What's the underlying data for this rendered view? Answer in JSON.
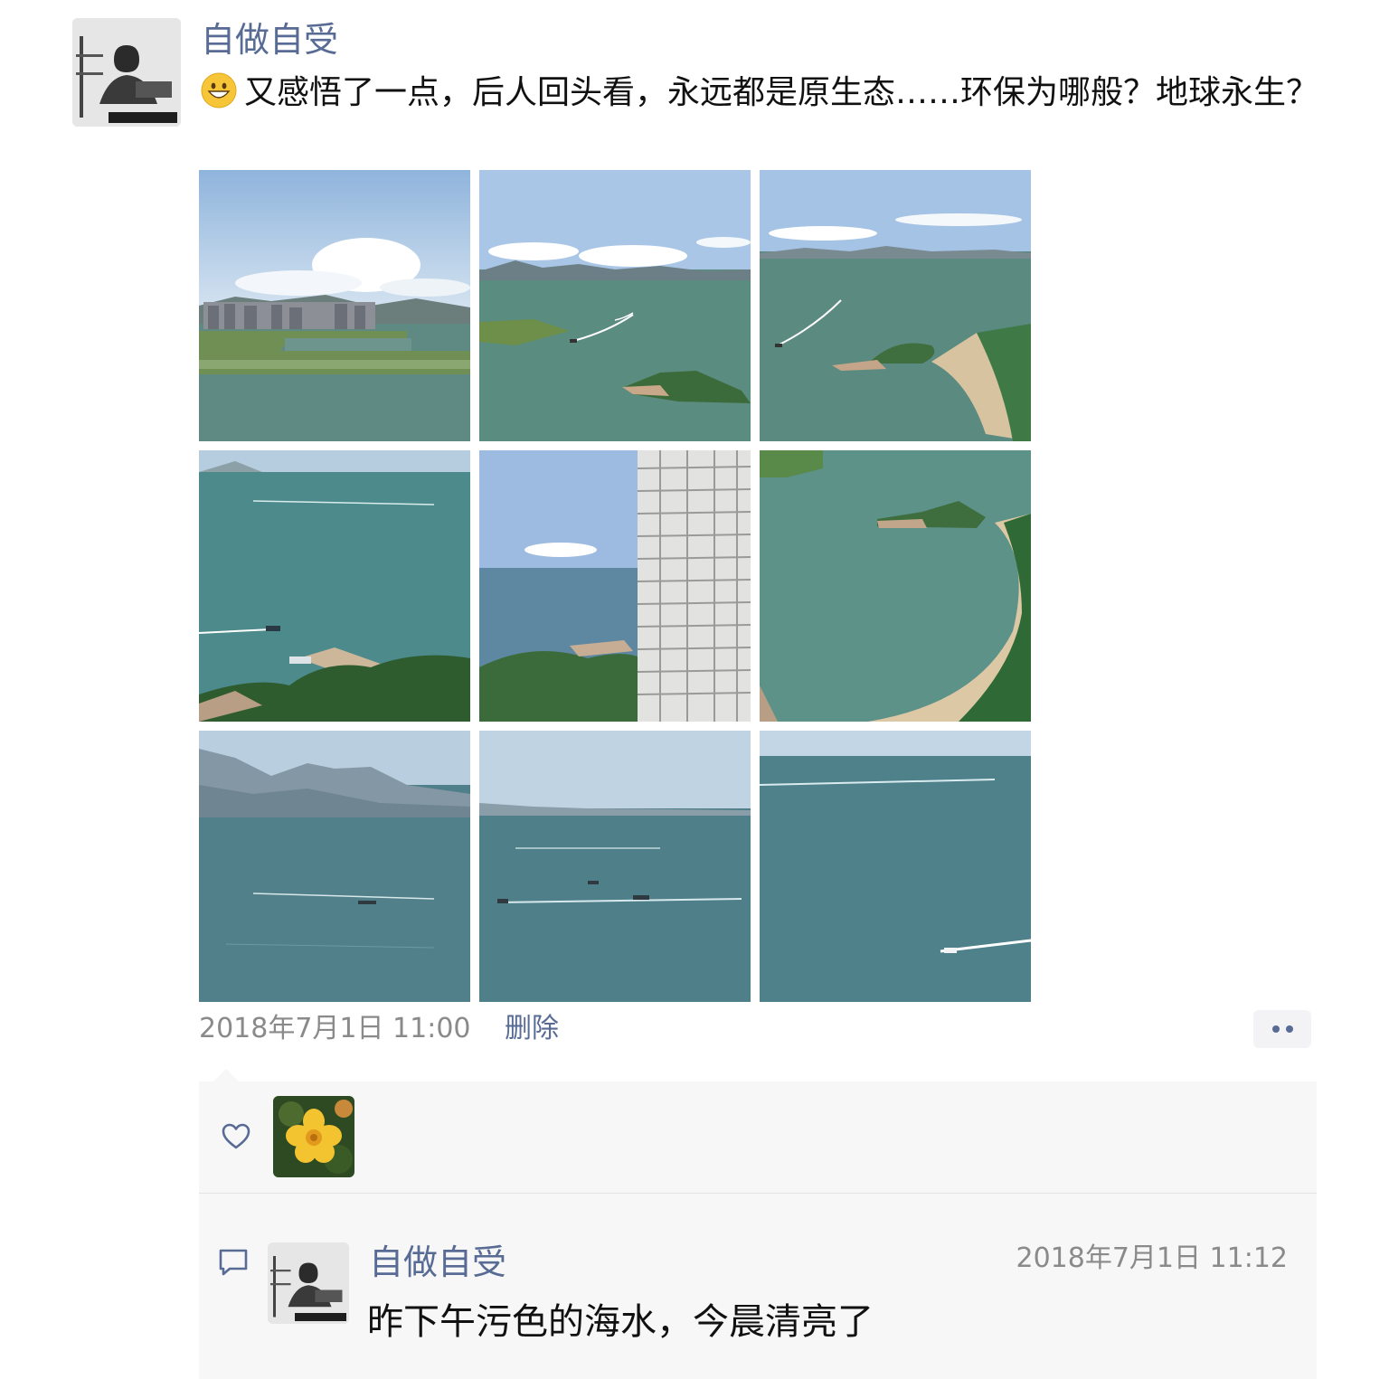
{
  "post": {
    "author": "自做自受",
    "avatar_icon": "user-avatar-icon",
    "emoji_icon": "grinning-face-emoji",
    "text": "又感悟了一点，后人回头看，永远都是原生态……环保为哪般？地球永生？",
    "time": "2018年7月1日 11:00",
    "delete_label": "删除",
    "more_icon": "more-dots-icon",
    "photos": [
      {
        "icon": "photo-coast-buildings"
      },
      {
        "icon": "photo-sea-boats-islet"
      },
      {
        "icon": "photo-bay-boat-islet"
      },
      {
        "icon": "photo-sea-pier-trees"
      },
      {
        "icon": "photo-sea-building"
      },
      {
        "icon": "photo-beach-islet"
      },
      {
        "icon": "photo-sea-mountains"
      },
      {
        "icon": "photo-open-sea"
      },
      {
        "icon": "photo-sea-speedboat"
      }
    ]
  },
  "likes": {
    "icon": "heart-icon",
    "users": [
      {
        "avatar_icon": "flower-avatar-icon"
      }
    ]
  },
  "comments": [
    {
      "icon": "comment-icon",
      "author": "自做自受",
      "time": "2018年7月1日 11:12",
      "text": "昨下午污色的海水，今晨清亮了"
    }
  ],
  "colors": {
    "link": "#576b95",
    "text": "#111111",
    "meta": "#8a8a8a",
    "panel": "#f7f7f7"
  }
}
